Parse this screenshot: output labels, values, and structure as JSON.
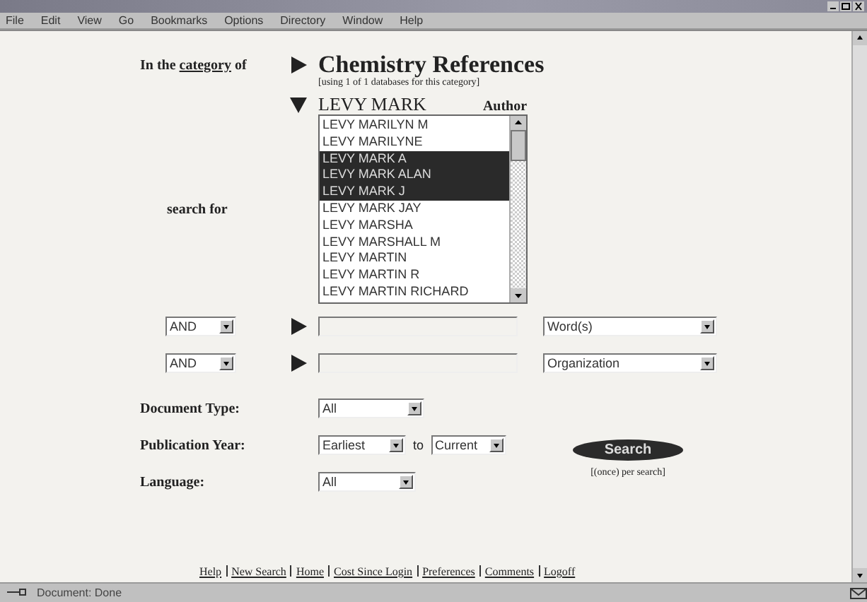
{
  "menu": [
    "File",
    "Edit",
    "View",
    "Go",
    "Bookmarks",
    "Options",
    "Directory",
    "Window",
    "Help"
  ],
  "category": {
    "prefix": "In the",
    "link": "category",
    "suffix": "of",
    "title": "Chemistry References",
    "note": "[using 1 of 1 databases for this category]"
  },
  "author": {
    "value": "LEVY MARK",
    "field": "Author",
    "search_label": "search for",
    "list": [
      {
        "text": "LEVY MARILYN M",
        "selected": false
      },
      {
        "text": "LEVY MARILYNE",
        "selected": false
      },
      {
        "text": "LEVY MARK A",
        "selected": true
      },
      {
        "text": "LEVY MARK ALAN",
        "selected": true
      },
      {
        "text": "LEVY MARK J",
        "selected": true
      },
      {
        "text": "LEVY MARK JAY",
        "selected": false
      },
      {
        "text": "LEVY MARSHA",
        "selected": false
      },
      {
        "text": "LEVY MARSHALL M",
        "selected": false
      },
      {
        "text": "LEVY MARTIN",
        "selected": false
      },
      {
        "text": "LEVY MARTIN R",
        "selected": false
      },
      {
        "text": "LEVY MARTIN RICHARD",
        "selected": false
      }
    ]
  },
  "terms": [
    {
      "operator": "AND",
      "field": "Word(s)"
    },
    {
      "operator": "AND",
      "field": "Organization"
    }
  ],
  "document_type": {
    "label": "Document Type:",
    "value": "All"
  },
  "publication_year": {
    "label": "Publication Year:",
    "from": "Earliest",
    "to_label": "to",
    "to": "Current"
  },
  "language": {
    "label": "Language:",
    "value": "All"
  },
  "search": {
    "button": "Search",
    "note": "[(once) per search]"
  },
  "footer_links": [
    "Help",
    "New Search",
    "Home",
    "Cost Since Login",
    "Preferences",
    "Comments",
    "Logoff"
  ],
  "status_bar": {
    "text": "Document: Done"
  }
}
